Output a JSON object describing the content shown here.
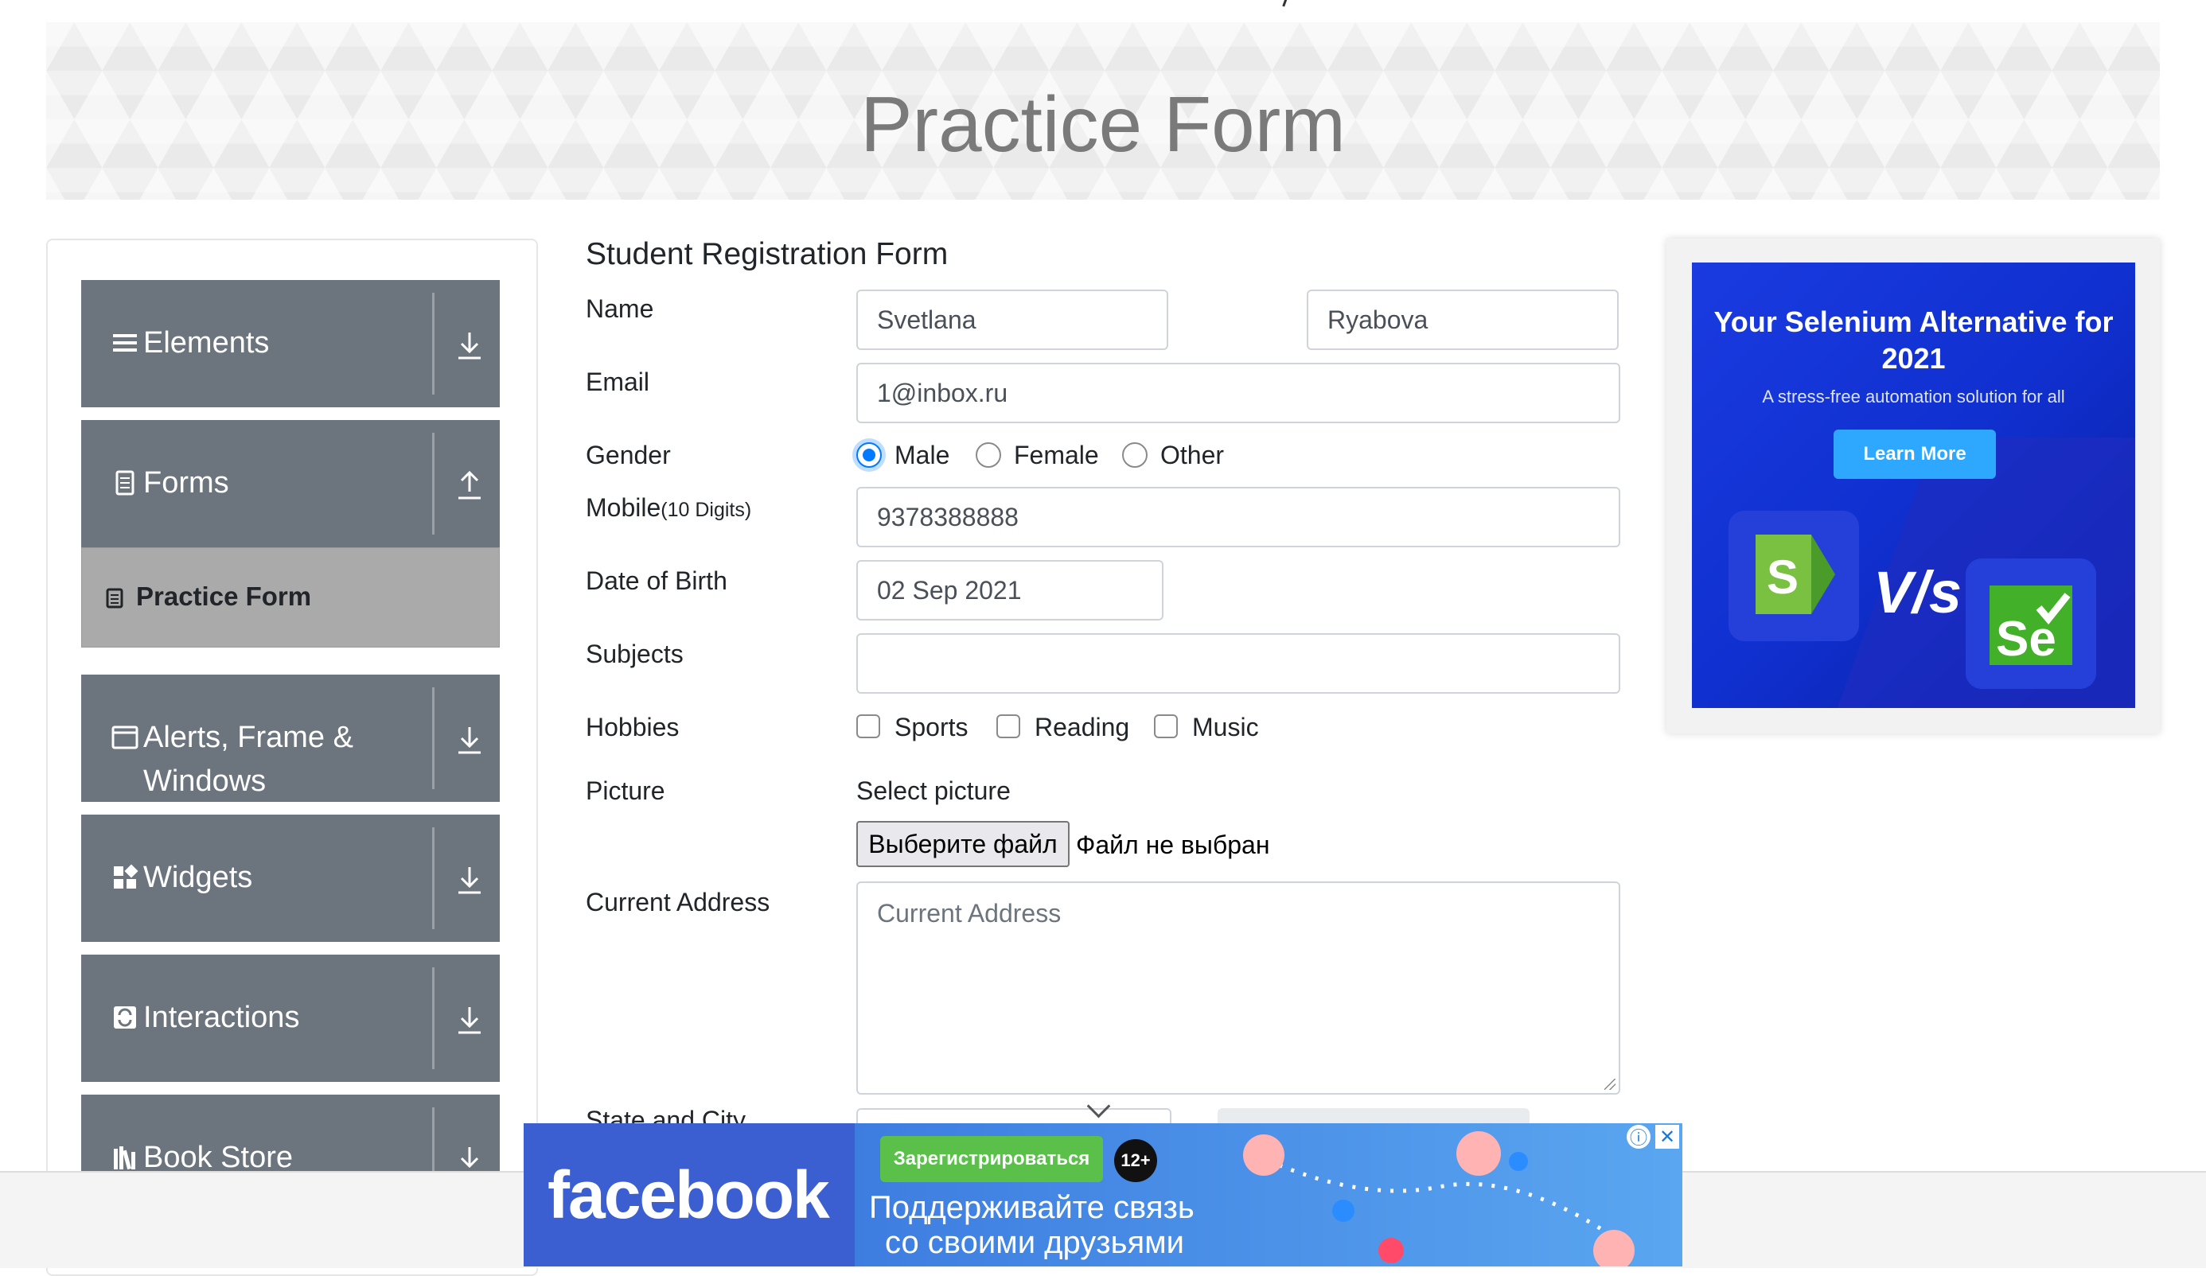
{
  "header": {
    "title": "Practice Form"
  },
  "sidebar": {
    "groups": [
      {
        "label": "Elements",
        "icon": "hamburger-icon",
        "arrow": "down"
      },
      {
        "label": "Forms",
        "icon": "document-icon",
        "arrow": "up"
      },
      {
        "label": "Alerts, Frame & Windows",
        "icon": "window-icon",
        "arrow": "down"
      },
      {
        "label": "Widgets",
        "icon": "widgets-icon",
        "arrow": "down"
      },
      {
        "label": "Interactions",
        "icon": "interactions-icon",
        "arrow": "down"
      },
      {
        "label": "Book Store",
        "icon": "books-icon",
        "arrow": "down"
      }
    ],
    "active_item": "Practice Form"
  },
  "form": {
    "title": "Student Registration Form",
    "name_label": "Name",
    "first_name": "Svetlana",
    "last_name": "Ryabova",
    "email_label": "Email",
    "email": "1@inbox.ru",
    "gender_label": "Gender",
    "gender_options": [
      "Male",
      "Female",
      "Other"
    ],
    "gender_selected": "Male",
    "mobile_label": "Mobile",
    "mobile_hint": "(10 Digits)",
    "mobile": "9378388888",
    "dob_label": "Date of Birth",
    "dob": "02 Sep 2021",
    "subjects_label": "Subjects",
    "subjects": "",
    "hobbies_label": "Hobbies",
    "hobbies": [
      "Sports",
      "Reading",
      "Music"
    ],
    "picture_label": "Picture",
    "picture_hint": "Select picture",
    "file_button": "Выберите файл",
    "file_status": "Файл не выбран",
    "address_label": "Current Address",
    "address_placeholder": "Current Address",
    "state_city_label": "State and City"
  },
  "ad_right": {
    "title": "Your Selenium Alternative for 2021",
    "subtitle": "A stress-free automation solution for all",
    "button": "Learn More",
    "vs": "V/s",
    "accent": "#2ea8ff"
  },
  "ad_bottom": {
    "logo": "facebook",
    "register": "Зарегистрироваться",
    "age": "12+",
    "line1": "Поддерживайте связь",
    "line2": "со своими друзьями"
  }
}
